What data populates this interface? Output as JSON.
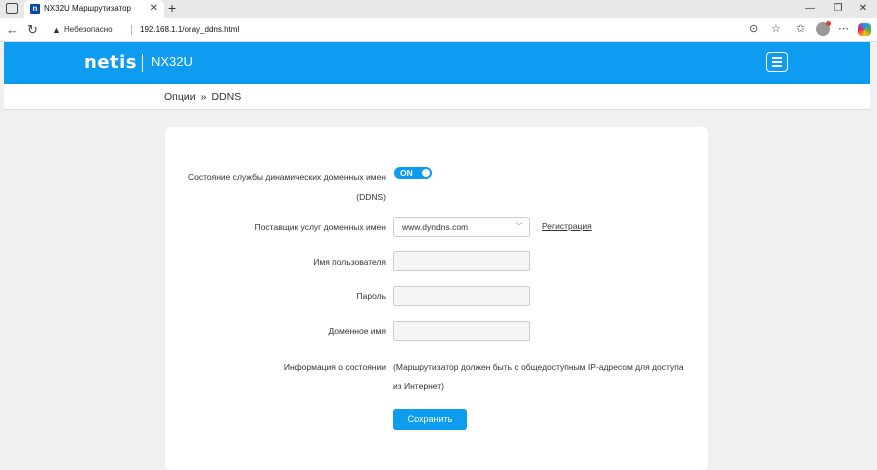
{
  "browser": {
    "tab_title": "NX32U Маршрутизатор",
    "favicon_letter": "n",
    "insecure_label": "Небезопасно",
    "url": "192.168.1.1/oray_ddns.html"
  },
  "header": {
    "logo": "netis",
    "model": "NX32U"
  },
  "breadcrumb": {
    "parent": "Опции",
    "separator": "»",
    "current": "DDNS"
  },
  "form": {
    "service_state_label_line1": "Состояние службы динамических доменных имен",
    "service_state_label_line2": "(DDNS)",
    "toggle_label": "ON",
    "provider_label": "Поставщик услуг доменных имен",
    "provider_value": "www.dyndns.com",
    "register_link": "Регистрация",
    "username_label": "Имя пользователя",
    "password_label": "Пароль",
    "domain_label": "Доменное имя",
    "status_label": "Информация о состоянии",
    "status_line1": "(Маршрутизатор должен быть с общедоступным IP-адресом для доступа",
    "status_line2": "из Интернет)",
    "save_button": "Сохранить"
  },
  "colors": {
    "accent": "#0d9cf0"
  }
}
